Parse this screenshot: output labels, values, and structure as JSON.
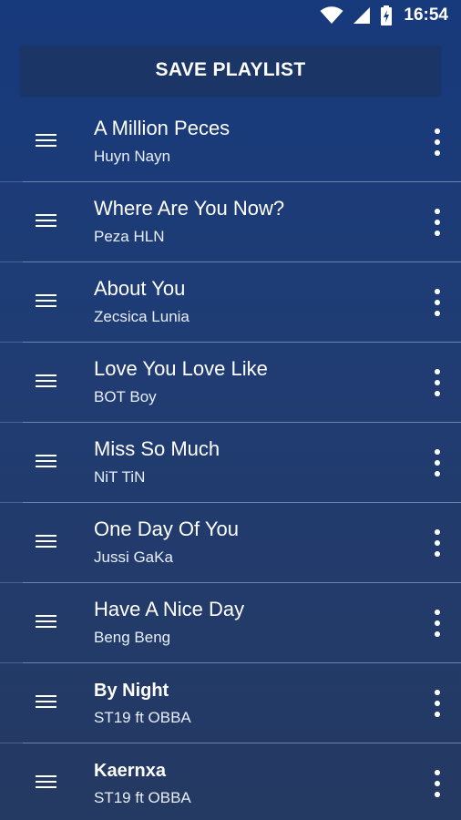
{
  "status_bar": {
    "time": "16:54",
    "icons": [
      "wifi-icon",
      "cell-signal-icon",
      "battery-charging-icon"
    ]
  },
  "save_button": {
    "label": "SAVE PLAYLIST"
  },
  "playlist": [
    {
      "title": "A Million Peces",
      "artist": "Huyn Nayn",
      "bold": false
    },
    {
      "title": "Where Are You Now?",
      "artist": "Peza HLN",
      "bold": false
    },
    {
      "title": "About You",
      "artist": "Zecsica Lunia",
      "bold": false
    },
    {
      "title": "Love You Love Like",
      "artist": "BOT Boy",
      "bold": false
    },
    {
      "title": "Miss So Much",
      "artist": "NiT TiN",
      "bold": false
    },
    {
      "title": "One Day Of You",
      "artist": "Jussi GaKa",
      "bold": false
    },
    {
      "title": "Have A Nice Day",
      "artist": "Beng Beng",
      "bold": false
    },
    {
      "title": "By Night",
      "artist": "ST19 ft OBBA",
      "bold": true
    },
    {
      "title": "Kaernxa",
      "artist": "ST19 ft OBBA",
      "bold": true
    }
  ],
  "colors": {
    "background_top": "#173a7c",
    "background_bottom": "#253a62",
    "button": "#1a3566",
    "text": "#ffffff"
  }
}
